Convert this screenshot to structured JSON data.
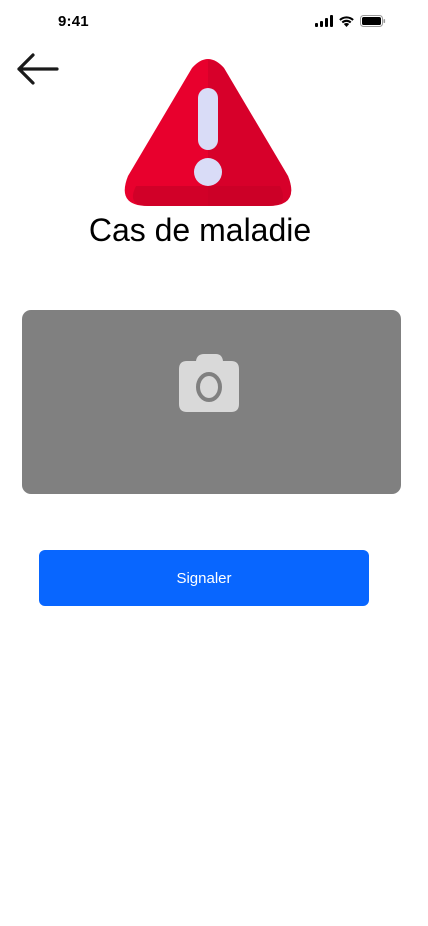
{
  "status_bar": {
    "time": "9:41",
    "icons": [
      "signal-icon",
      "wifi-icon",
      "battery-icon"
    ]
  },
  "header": {
    "back_icon": "arrow-left-icon",
    "alert_icon": "warning-triangle-icon",
    "title": "Cas de maladie"
  },
  "photo_upload": {
    "icon": "camera-icon"
  },
  "actions": {
    "report_label": "Signaler"
  },
  "colors": {
    "warning_red": "#e8002d",
    "photo_area": "#808080",
    "camera_glyph": "#d9d9d9",
    "primary_button": "#0866ff"
  }
}
